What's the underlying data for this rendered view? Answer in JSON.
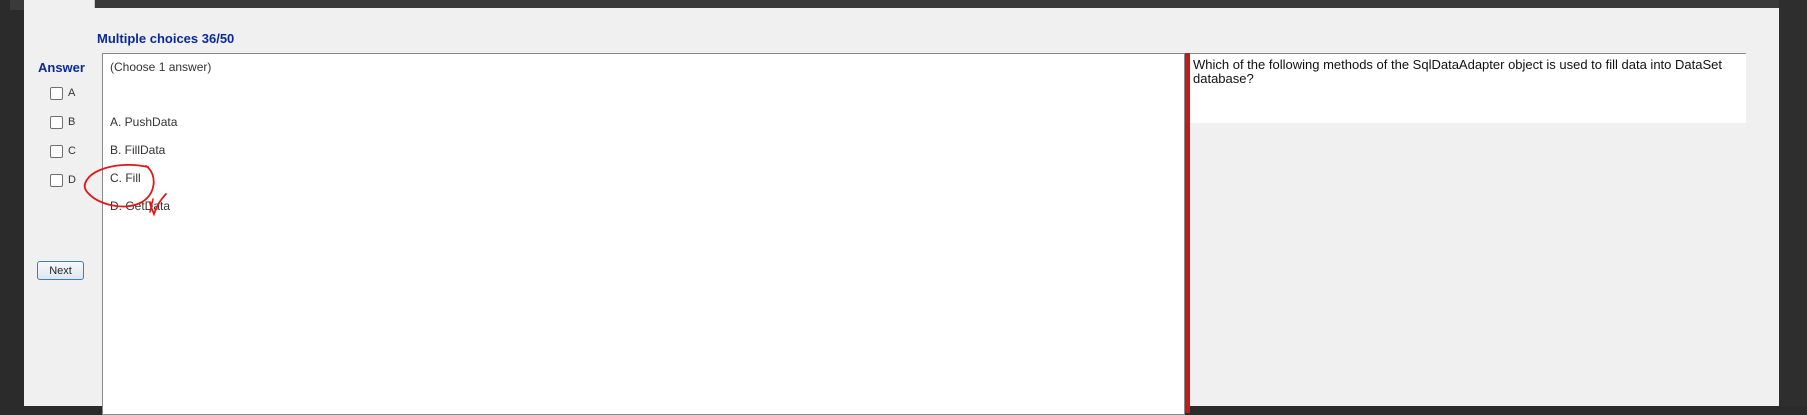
{
  "title": "Multiple choices 36/50",
  "answer_panel": {
    "label": "Answer",
    "options": [
      "A",
      "B",
      "C",
      "D"
    ],
    "next_label": "Next"
  },
  "answers": {
    "instruction": "(Choose 1 answer)",
    "items": [
      "A.  PushData",
      "B.  FillData",
      "C.  Fill",
      "D.  GetData"
    ]
  },
  "question": {
    "text": "Which of the following methods of the SqlDataAdapter object is used to fill data into DataSet database?"
  },
  "colors": {
    "title": "#0a2a9a",
    "divider": "#c21b1b",
    "annotation": "#e01818"
  }
}
